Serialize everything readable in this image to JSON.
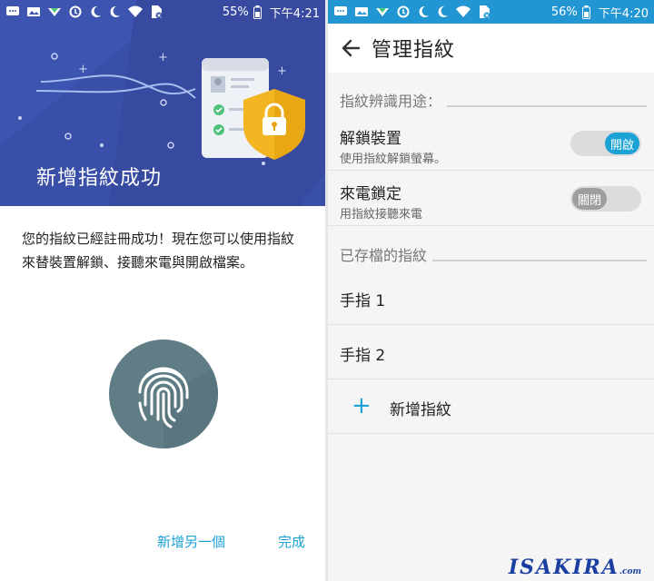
{
  "left": {
    "status": {
      "battery_pct": "55%",
      "time": "下午4:21"
    },
    "hero_title": "新增指紋成功",
    "message": "您的指紋已經註冊成功！現在您可以使用指紋來替裝置解鎖、接聽來電與開啟檔案。",
    "actions": {
      "add_another": "新增另一個",
      "done": "完成"
    }
  },
  "right": {
    "status": {
      "battery_pct": "56%",
      "time": "下午4:20"
    },
    "title": "管理指紋",
    "usage_header": "指紋辨識用途：",
    "prefs": [
      {
        "title": "解鎖裝置",
        "subtitle": "使用指紋解鎖螢幕。",
        "toggle_label": "開啟",
        "on": true
      },
      {
        "title": "來電鎖定",
        "subtitle": "用指紋接聽來電",
        "toggle_label": "關閉",
        "on": false
      }
    ],
    "saved_header": "已存檔的指紋",
    "fingerprints": [
      "手指 1",
      "手指 2"
    ],
    "add_label": "新增指紋"
  },
  "watermark": {
    "main": "ISAKIRA",
    "suffix": ".com"
  },
  "colors": {
    "accent": "#1ba3d6",
    "hero_bg": "#3a4fa8",
    "status_bar": "#2196d3",
    "fingerprint_circle": "#607d86"
  },
  "icons": [
    "chat-icon",
    "image-icon",
    "signal-arrow-icon",
    "data-saver-icon",
    "moon-icon",
    "wifi-icon",
    "sim-icon",
    "back-arrow-icon",
    "fingerprint-icon",
    "shield-lock-icon"
  ]
}
